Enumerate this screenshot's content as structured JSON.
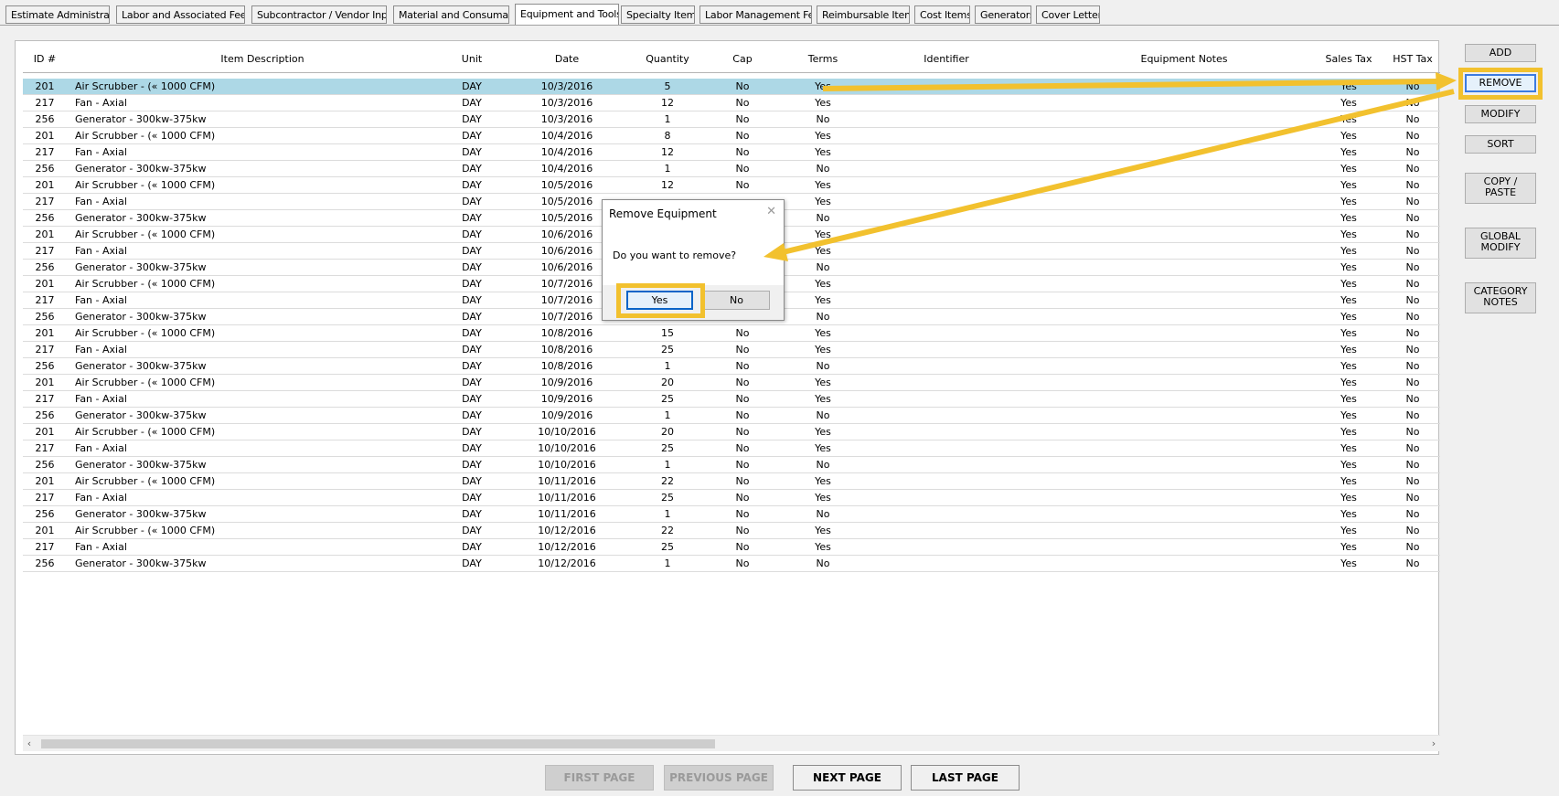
{
  "tabs": [
    {
      "label": "Estimate Administration",
      "active": false
    },
    {
      "label": "Labor and Associated Fees",
      "active": false
    },
    {
      "label": "Subcontractor / Vendor Input",
      "active": false
    },
    {
      "label": "Material and Consumable",
      "active": false
    },
    {
      "label": "Equipment and Tools",
      "active": true
    },
    {
      "label": "Specialty Items",
      "active": false
    },
    {
      "label": "Labor Management Fee",
      "active": false
    },
    {
      "label": "Reimbursable Items",
      "active": false
    },
    {
      "label": "Cost Items",
      "active": false
    },
    {
      "label": "Generators",
      "active": false
    },
    {
      "label": "Cover Letter",
      "active": false
    }
  ],
  "grid": {
    "columns": [
      "ID #",
      "Item Description",
      "Unit",
      "Date",
      "Quantity",
      "Cap",
      "Terms",
      "Identifier",
      "Equipment Notes",
      "Sales Tax",
      "HST Tax"
    ],
    "rows": [
      {
        "id": "201",
        "desc": "Air Scrubber - (« 1000 CFM)",
        "unit": "DAY",
        "date": "10/3/2016",
        "qty": "5",
        "cap": "No",
        "terms": "Yes",
        "identifier": "",
        "notes": "",
        "sales": "Yes",
        "hst": "No",
        "selected": true
      },
      {
        "id": "217",
        "desc": "Fan - Axial",
        "unit": "DAY",
        "date": "10/3/2016",
        "qty": "12",
        "cap": "No",
        "terms": "Yes",
        "identifier": "",
        "notes": "",
        "sales": "Yes",
        "hst": "No"
      },
      {
        "id": "256",
        "desc": "Generator - 300kw-375kw",
        "unit": "DAY",
        "date": "10/3/2016",
        "qty": "1",
        "cap": "No",
        "terms": "No",
        "identifier": "",
        "notes": "",
        "sales": "Yes",
        "hst": "No"
      },
      {
        "id": "201",
        "desc": "Air Scrubber - (« 1000 CFM)",
        "unit": "DAY",
        "date": "10/4/2016",
        "qty": "8",
        "cap": "No",
        "terms": "Yes",
        "identifier": "",
        "notes": "",
        "sales": "Yes",
        "hst": "No"
      },
      {
        "id": "217",
        "desc": "Fan - Axial",
        "unit": "DAY",
        "date": "10/4/2016",
        "qty": "12",
        "cap": "No",
        "terms": "Yes",
        "identifier": "",
        "notes": "",
        "sales": "Yes",
        "hst": "No"
      },
      {
        "id": "256",
        "desc": "Generator - 300kw-375kw",
        "unit": "DAY",
        "date": "10/4/2016",
        "qty": "1",
        "cap": "No",
        "terms": "No",
        "identifier": "",
        "notes": "",
        "sales": "Yes",
        "hst": "No"
      },
      {
        "id": "201",
        "desc": "Air Scrubber - (« 1000 CFM)",
        "unit": "DAY",
        "date": "10/5/2016",
        "qty": "12",
        "cap": "No",
        "terms": "Yes",
        "identifier": "",
        "notes": "",
        "sales": "Yes",
        "hst": "No"
      },
      {
        "id": "217",
        "desc": "Fan - Axial",
        "unit": "DAY",
        "date": "10/5/2016",
        "qty": "",
        "cap": "",
        "terms": "Yes",
        "identifier": "",
        "notes": "",
        "sales": "Yes",
        "hst": "No"
      },
      {
        "id": "256",
        "desc": "Generator - 300kw-375kw",
        "unit": "DAY",
        "date": "10/5/2016",
        "qty": "",
        "cap": "",
        "terms": "No",
        "identifier": "",
        "notes": "",
        "sales": "Yes",
        "hst": "No"
      },
      {
        "id": "201",
        "desc": "Air Scrubber - (« 1000 CFM)",
        "unit": "DAY",
        "date": "10/6/2016",
        "qty": "",
        "cap": "",
        "terms": "Yes",
        "identifier": "",
        "notes": "",
        "sales": "Yes",
        "hst": "No"
      },
      {
        "id": "217",
        "desc": "Fan - Axial",
        "unit": "DAY",
        "date": "10/6/2016",
        "qty": "",
        "cap": "",
        "terms": "Yes",
        "identifier": "",
        "notes": "",
        "sales": "Yes",
        "hst": "No"
      },
      {
        "id": "256",
        "desc": "Generator - 300kw-375kw",
        "unit": "DAY",
        "date": "10/6/2016",
        "qty": "",
        "cap": "",
        "terms": "No",
        "identifier": "",
        "notes": "",
        "sales": "Yes",
        "hst": "No"
      },
      {
        "id": "201",
        "desc": "Air Scrubber - (« 1000 CFM)",
        "unit": "DAY",
        "date": "10/7/2016",
        "qty": "",
        "cap": "",
        "terms": "Yes",
        "identifier": "",
        "notes": "",
        "sales": "Yes",
        "hst": "No"
      },
      {
        "id": "217",
        "desc": "Fan - Axial",
        "unit": "DAY",
        "date": "10/7/2016",
        "qty": "",
        "cap": "",
        "terms": "Yes",
        "identifier": "",
        "notes": "",
        "sales": "Yes",
        "hst": "No"
      },
      {
        "id": "256",
        "desc": "Generator - 300kw-375kw",
        "unit": "DAY",
        "date": "10/7/2016",
        "qty": "1",
        "cap": "",
        "terms": "No",
        "identifier": "",
        "notes": "",
        "sales": "Yes",
        "hst": "No"
      },
      {
        "id": "201",
        "desc": "Air Scrubber - (« 1000 CFM)",
        "unit": "DAY",
        "date": "10/8/2016",
        "qty": "15",
        "cap": "No",
        "terms": "Yes",
        "identifier": "",
        "notes": "",
        "sales": "Yes",
        "hst": "No"
      },
      {
        "id": "217",
        "desc": "Fan - Axial",
        "unit": "DAY",
        "date": "10/8/2016",
        "qty": "25",
        "cap": "No",
        "terms": "Yes",
        "identifier": "",
        "notes": "",
        "sales": "Yes",
        "hst": "No"
      },
      {
        "id": "256",
        "desc": "Generator - 300kw-375kw",
        "unit": "DAY",
        "date": "10/8/2016",
        "qty": "1",
        "cap": "No",
        "terms": "No",
        "identifier": "",
        "notes": "",
        "sales": "Yes",
        "hst": "No"
      },
      {
        "id": "201",
        "desc": "Air Scrubber - (« 1000 CFM)",
        "unit": "DAY",
        "date": "10/9/2016",
        "qty": "20",
        "cap": "No",
        "terms": "Yes",
        "identifier": "",
        "notes": "",
        "sales": "Yes",
        "hst": "No"
      },
      {
        "id": "217",
        "desc": "Fan - Axial",
        "unit": "DAY",
        "date": "10/9/2016",
        "qty": "25",
        "cap": "No",
        "terms": "Yes",
        "identifier": "",
        "notes": "",
        "sales": "Yes",
        "hst": "No"
      },
      {
        "id": "256",
        "desc": "Generator - 300kw-375kw",
        "unit": "DAY",
        "date": "10/9/2016",
        "qty": "1",
        "cap": "No",
        "terms": "No",
        "identifier": "",
        "notes": "",
        "sales": "Yes",
        "hst": "No"
      },
      {
        "id": "201",
        "desc": "Air Scrubber - (« 1000 CFM)",
        "unit": "DAY",
        "date": "10/10/2016",
        "qty": "20",
        "cap": "No",
        "terms": "Yes",
        "identifier": "",
        "notes": "",
        "sales": "Yes",
        "hst": "No"
      },
      {
        "id": "217",
        "desc": "Fan - Axial",
        "unit": "DAY",
        "date": "10/10/2016",
        "qty": "25",
        "cap": "No",
        "terms": "Yes",
        "identifier": "",
        "notes": "",
        "sales": "Yes",
        "hst": "No"
      },
      {
        "id": "256",
        "desc": "Generator - 300kw-375kw",
        "unit": "DAY",
        "date": "10/10/2016",
        "qty": "1",
        "cap": "No",
        "terms": "No",
        "identifier": "",
        "notes": "",
        "sales": "Yes",
        "hst": "No"
      },
      {
        "id": "201",
        "desc": "Air Scrubber - (« 1000 CFM)",
        "unit": "DAY",
        "date": "10/11/2016",
        "qty": "22",
        "cap": "No",
        "terms": "Yes",
        "identifier": "",
        "notes": "",
        "sales": "Yes",
        "hst": "No"
      },
      {
        "id": "217",
        "desc": "Fan - Axial",
        "unit": "DAY",
        "date": "10/11/2016",
        "qty": "25",
        "cap": "No",
        "terms": "Yes",
        "identifier": "",
        "notes": "",
        "sales": "Yes",
        "hst": "No"
      },
      {
        "id": "256",
        "desc": "Generator - 300kw-375kw",
        "unit": "DAY",
        "date": "10/11/2016",
        "qty": "1",
        "cap": "No",
        "terms": "No",
        "identifier": "",
        "notes": "",
        "sales": "Yes",
        "hst": "No"
      },
      {
        "id": "201",
        "desc": "Air Scrubber - (« 1000 CFM)",
        "unit": "DAY",
        "date": "10/12/2016",
        "qty": "22",
        "cap": "No",
        "terms": "Yes",
        "identifier": "",
        "notes": "",
        "sales": "Yes",
        "hst": "No"
      },
      {
        "id": "217",
        "desc": "Fan - Axial",
        "unit": "DAY",
        "date": "10/12/2016",
        "qty": "25",
        "cap": "No",
        "terms": "Yes",
        "identifier": "",
        "notes": "",
        "sales": "Yes",
        "hst": "No"
      },
      {
        "id": "256",
        "desc": "Generator - 300kw-375kw",
        "unit": "DAY",
        "date": "10/12/2016",
        "qty": "1",
        "cap": "No",
        "terms": "No",
        "identifier": "",
        "notes": "",
        "sales": "Yes",
        "hst": "No"
      }
    ]
  },
  "side_buttons": {
    "add": "ADD",
    "remove": "REMOVE",
    "modify": "MODIFY",
    "sort": "SORT",
    "copy_paste": [
      "COPY /",
      "PASTE"
    ],
    "global_modify": [
      "GLOBAL",
      "MODIFY"
    ],
    "category_notes": [
      "CATEGORY",
      "NOTES"
    ]
  },
  "nav_buttons": {
    "first": "FIRST PAGE",
    "previous": "PREVIOUS PAGE",
    "next": "NEXT PAGE",
    "last": "LAST PAGE"
  },
  "dialog": {
    "title": "Remove Equipment",
    "message": "Do you want to remove?",
    "yes": "Yes",
    "no": "No"
  },
  "icons": {
    "close": "close-icon",
    "scroll_left": "chevron-left-icon",
    "scroll_right": "chevron-right-icon"
  },
  "colors": {
    "selected_row": "#add8e6",
    "highlight": "#f2c12e",
    "focus_border": "#3c7be0"
  }
}
